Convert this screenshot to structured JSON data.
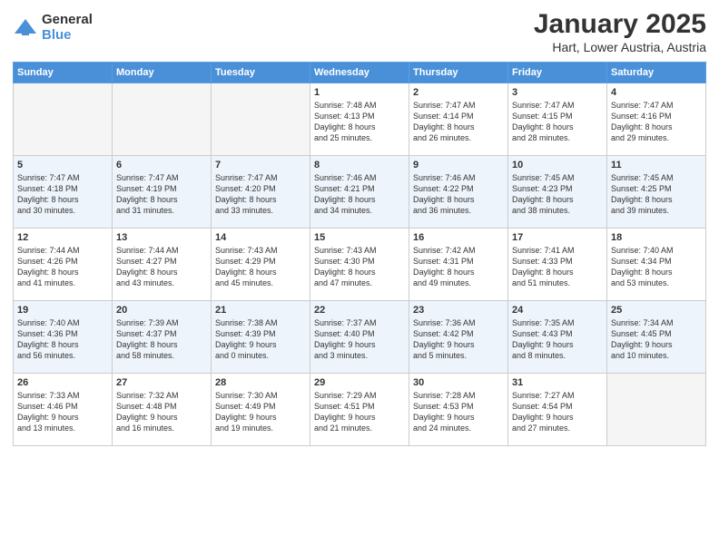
{
  "header": {
    "logo_general": "General",
    "logo_blue": "Blue",
    "month_title": "January 2025",
    "location": "Hart, Lower Austria, Austria"
  },
  "weekdays": [
    "Sunday",
    "Monday",
    "Tuesday",
    "Wednesday",
    "Thursday",
    "Friday",
    "Saturday"
  ],
  "weeks": [
    {
      "alt": false,
      "days": [
        {
          "num": "",
          "info": ""
        },
        {
          "num": "",
          "info": ""
        },
        {
          "num": "",
          "info": ""
        },
        {
          "num": "1",
          "info": "Sunrise: 7:48 AM\nSunset: 4:13 PM\nDaylight: 8 hours\nand 25 minutes."
        },
        {
          "num": "2",
          "info": "Sunrise: 7:47 AM\nSunset: 4:14 PM\nDaylight: 8 hours\nand 26 minutes."
        },
        {
          "num": "3",
          "info": "Sunrise: 7:47 AM\nSunset: 4:15 PM\nDaylight: 8 hours\nand 28 minutes."
        },
        {
          "num": "4",
          "info": "Sunrise: 7:47 AM\nSunset: 4:16 PM\nDaylight: 8 hours\nand 29 minutes."
        }
      ]
    },
    {
      "alt": true,
      "days": [
        {
          "num": "5",
          "info": "Sunrise: 7:47 AM\nSunset: 4:18 PM\nDaylight: 8 hours\nand 30 minutes."
        },
        {
          "num": "6",
          "info": "Sunrise: 7:47 AM\nSunset: 4:19 PM\nDaylight: 8 hours\nand 31 minutes."
        },
        {
          "num": "7",
          "info": "Sunrise: 7:47 AM\nSunset: 4:20 PM\nDaylight: 8 hours\nand 33 minutes."
        },
        {
          "num": "8",
          "info": "Sunrise: 7:46 AM\nSunset: 4:21 PM\nDaylight: 8 hours\nand 34 minutes."
        },
        {
          "num": "9",
          "info": "Sunrise: 7:46 AM\nSunset: 4:22 PM\nDaylight: 8 hours\nand 36 minutes."
        },
        {
          "num": "10",
          "info": "Sunrise: 7:45 AM\nSunset: 4:23 PM\nDaylight: 8 hours\nand 38 minutes."
        },
        {
          "num": "11",
          "info": "Sunrise: 7:45 AM\nSunset: 4:25 PM\nDaylight: 8 hours\nand 39 minutes."
        }
      ]
    },
    {
      "alt": false,
      "days": [
        {
          "num": "12",
          "info": "Sunrise: 7:44 AM\nSunset: 4:26 PM\nDaylight: 8 hours\nand 41 minutes."
        },
        {
          "num": "13",
          "info": "Sunrise: 7:44 AM\nSunset: 4:27 PM\nDaylight: 8 hours\nand 43 minutes."
        },
        {
          "num": "14",
          "info": "Sunrise: 7:43 AM\nSunset: 4:29 PM\nDaylight: 8 hours\nand 45 minutes."
        },
        {
          "num": "15",
          "info": "Sunrise: 7:43 AM\nSunset: 4:30 PM\nDaylight: 8 hours\nand 47 minutes."
        },
        {
          "num": "16",
          "info": "Sunrise: 7:42 AM\nSunset: 4:31 PM\nDaylight: 8 hours\nand 49 minutes."
        },
        {
          "num": "17",
          "info": "Sunrise: 7:41 AM\nSunset: 4:33 PM\nDaylight: 8 hours\nand 51 minutes."
        },
        {
          "num": "18",
          "info": "Sunrise: 7:40 AM\nSunset: 4:34 PM\nDaylight: 8 hours\nand 53 minutes."
        }
      ]
    },
    {
      "alt": true,
      "days": [
        {
          "num": "19",
          "info": "Sunrise: 7:40 AM\nSunset: 4:36 PM\nDaylight: 8 hours\nand 56 minutes."
        },
        {
          "num": "20",
          "info": "Sunrise: 7:39 AM\nSunset: 4:37 PM\nDaylight: 8 hours\nand 58 minutes."
        },
        {
          "num": "21",
          "info": "Sunrise: 7:38 AM\nSunset: 4:39 PM\nDaylight: 9 hours\nand 0 minutes."
        },
        {
          "num": "22",
          "info": "Sunrise: 7:37 AM\nSunset: 4:40 PM\nDaylight: 9 hours\nand 3 minutes."
        },
        {
          "num": "23",
          "info": "Sunrise: 7:36 AM\nSunset: 4:42 PM\nDaylight: 9 hours\nand 5 minutes."
        },
        {
          "num": "24",
          "info": "Sunrise: 7:35 AM\nSunset: 4:43 PM\nDaylight: 9 hours\nand 8 minutes."
        },
        {
          "num": "25",
          "info": "Sunrise: 7:34 AM\nSunset: 4:45 PM\nDaylight: 9 hours\nand 10 minutes."
        }
      ]
    },
    {
      "alt": false,
      "days": [
        {
          "num": "26",
          "info": "Sunrise: 7:33 AM\nSunset: 4:46 PM\nDaylight: 9 hours\nand 13 minutes."
        },
        {
          "num": "27",
          "info": "Sunrise: 7:32 AM\nSunset: 4:48 PM\nDaylight: 9 hours\nand 16 minutes."
        },
        {
          "num": "28",
          "info": "Sunrise: 7:30 AM\nSunset: 4:49 PM\nDaylight: 9 hours\nand 19 minutes."
        },
        {
          "num": "29",
          "info": "Sunrise: 7:29 AM\nSunset: 4:51 PM\nDaylight: 9 hours\nand 21 minutes."
        },
        {
          "num": "30",
          "info": "Sunrise: 7:28 AM\nSunset: 4:53 PM\nDaylight: 9 hours\nand 24 minutes."
        },
        {
          "num": "31",
          "info": "Sunrise: 7:27 AM\nSunset: 4:54 PM\nDaylight: 9 hours\nand 27 minutes."
        },
        {
          "num": "",
          "info": ""
        }
      ]
    }
  ]
}
